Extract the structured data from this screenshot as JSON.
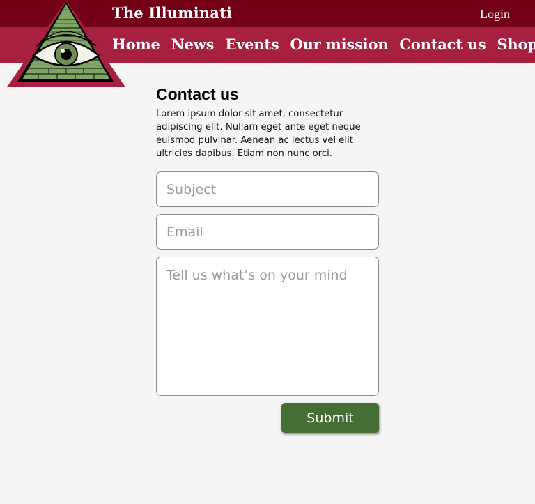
{
  "header": {
    "site_title": "The Illuminati",
    "login_label": "Login"
  },
  "nav": {
    "items": [
      {
        "label": "Home"
      },
      {
        "label": "News"
      },
      {
        "label": "Events"
      },
      {
        "label": "Our mission"
      },
      {
        "label": "Contact us"
      },
      {
        "label": "Shop"
      }
    ]
  },
  "logo": {
    "icon": "all-seeing-eye-pyramid-icon"
  },
  "main": {
    "heading": "Contact us",
    "intro": "Lorem ipsum dolor sit amet, consectetur adipiscing elit. Nullam eget ante eget neque euismod pulvinar. Aenean ac lectus vel elit ultricies dapibus. Etiam non nunc orci."
  },
  "form": {
    "subject_placeholder": "Subject",
    "email_placeholder": "Email",
    "message_placeholder": "Tell us what’s on your mind",
    "submit_label": "Submit"
  },
  "colors": {
    "topbar": "#740018",
    "navbar": "#a8203f",
    "background": "#f5f5f5",
    "submit": "#466e34",
    "eye_green": "#7ea563"
  }
}
